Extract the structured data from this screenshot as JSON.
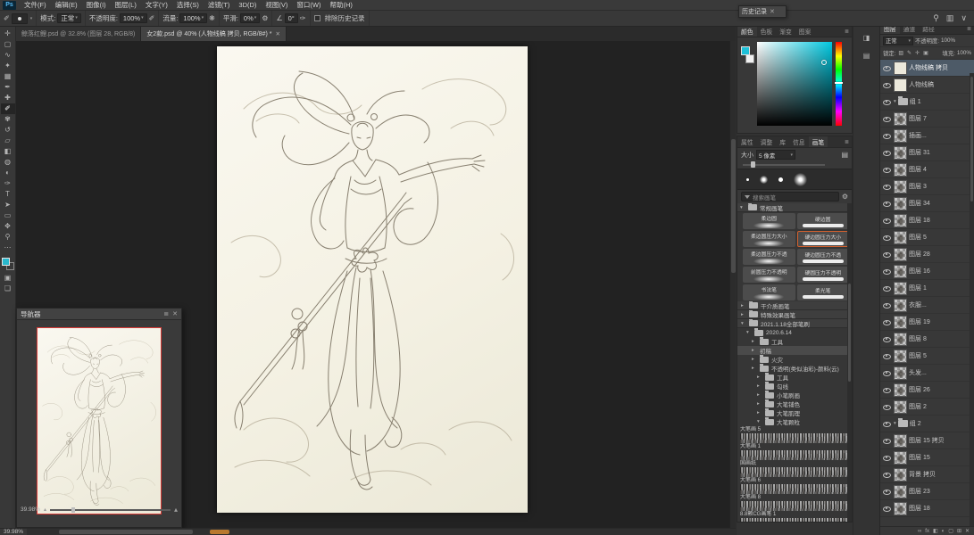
{
  "app": {
    "logo": "Ps"
  },
  "ui": {
    "close_glyph": "✕",
    "caret": "∨",
    "menu_glyph": "≣",
    "collapse_glyph": "«"
  },
  "menubar": {
    "items": [
      "文件(F)",
      "编辑(E)",
      "图像(I)",
      "图层(L)",
      "文字(Y)",
      "选择(S)",
      "滤镜(T)",
      "3D(D)",
      "视图(V)",
      "窗口(W)",
      "帮助(H)"
    ]
  },
  "optionsbar": {
    "tool_glyph": "✐",
    "mode_label": "模式:",
    "mode_value": "正常",
    "opacity_label": "不透明度:",
    "opacity_value": "100%",
    "pressure_glyph": "✐",
    "flow_label": "流量:",
    "flow_value": "100%",
    "airbrush_glyph": "❋",
    "smooth_label": "平滑:",
    "smooth_value": "0%",
    "gear_glyph": "⚙",
    "angle_glyph": "∠",
    "angle_value": "0°",
    "size_pressure_glyph": "✑",
    "checkbox_label": "排除历史记录",
    "right_icons": [
      {
        "name": "search-icon",
        "glyph": "⚲"
      },
      {
        "name": "workspace-layout-icon",
        "glyph": "▥"
      },
      {
        "name": "chevron-down-icon",
        "glyph": "∨"
      }
    ]
  },
  "toolbar": {
    "foreground_color": "#29b8cd",
    "background_color": "#f2f2f2",
    "tools": [
      {
        "name": "move-tool",
        "glyph": "✛",
        "cls": ""
      },
      {
        "name": "marquee-tool",
        "glyph": "▢",
        "cls": ""
      },
      {
        "name": "lasso-tool",
        "glyph": "∿",
        "cls": ""
      },
      {
        "name": "magic-wand-tool",
        "glyph": "✦",
        "cls": ""
      },
      {
        "name": "crop-tool",
        "glyph": "▦",
        "cls": ""
      },
      {
        "name": "eyedropper-tool",
        "glyph": "✒",
        "cls": ""
      },
      {
        "name": "healing-brush-tool",
        "glyph": "✚",
        "cls": ""
      },
      {
        "name": "brush-tool",
        "glyph": "✐",
        "cls": "active"
      },
      {
        "name": "clone-stamp-tool",
        "glyph": "✾",
        "cls": ""
      },
      {
        "name": "history-brush-tool",
        "glyph": "↺",
        "cls": ""
      },
      {
        "name": "eraser-tool",
        "glyph": "▱",
        "cls": ""
      },
      {
        "name": "gradient-tool",
        "glyph": "◧",
        "cls": ""
      },
      {
        "name": "blur-tool",
        "glyph": "◍",
        "cls": ""
      },
      {
        "name": "dodge-tool",
        "glyph": "◐",
        "cls": ""
      },
      {
        "name": "pen-tool",
        "glyph": "✑",
        "cls": ""
      },
      {
        "name": "type-tool",
        "glyph": "T",
        "cls": ""
      },
      {
        "name": "path-select-tool",
        "glyph": "➤",
        "cls": ""
      },
      {
        "name": "shape-tool",
        "glyph": "▭",
        "cls": ""
      },
      {
        "name": "hand-tool",
        "glyph": "✥",
        "cls": ""
      },
      {
        "name": "zoom-tool",
        "glyph": "⚲",
        "cls": ""
      },
      {
        "name": "edit-toolbar-button",
        "glyph": "⋯",
        "cls": ""
      }
    ],
    "extra": [
      {
        "name": "quick-mask-button",
        "glyph": "▣"
      },
      {
        "name": "screen-mode-button",
        "glyph": "❏"
      }
    ]
  },
  "tabs": {
    "items": [
      {
        "label": "鲸落红鲤.psd @ 32.8% (图层 28, RGB/8)",
        "cls": ""
      },
      {
        "label": "女2款.psd @ 40% (人物线稿 拷贝, RGB/8#) *",
        "cls": "active"
      }
    ]
  },
  "statusbar": {
    "zoom": "39.98%"
  },
  "navigator": {
    "title": "导航器",
    "zoom": "39.98%"
  },
  "history_panel": {
    "title": "历史记录"
  },
  "color_panel": {
    "tabs": [
      {
        "label": "颜色",
        "cls": "active"
      },
      {
        "label": "色板"
      },
      {
        "label": "渐变"
      },
      {
        "label": "图案"
      }
    ],
    "current_color": "#1ec0d8"
  },
  "brushes_panel": {
    "tabs": [
      {
        "label": "属性"
      },
      {
        "label": "调整"
      },
      {
        "label": "库"
      },
      {
        "label": "信息"
      },
      {
        "label": "画笔",
        "cls": "active"
      }
    ],
    "size_label": "大小",
    "size_value": "5 像素",
    "search_placeholder": "搜索画笔",
    "group_regular": "常规画笔",
    "pairs": [
      {
        "left": "柔边圆",
        "right": "硬边圆"
      },
      {
        "left": "柔边圆压力大小",
        "right": "硬边圆压力大小",
        "right_cls": "sel"
      },
      {
        "left": "柔边圆压力不透",
        "right": "硬边圆压力不透"
      },
      {
        "left": "前圆压力不透明",
        "right": "硬圆压力不透明"
      },
      {
        "left": "书法笔",
        "right": "柔光笔"
      }
    ],
    "tree": [
      {
        "label": "干介质画笔",
        "cls": "grp"
      },
      {
        "label": "特殊效果画笔",
        "cls": "grp"
      },
      {
        "label": "2021.1.18全部笔刷",
        "cls": "grp open"
      },
      {
        "label": "2020.6.14",
        "cls": "ind1 open"
      },
      {
        "label": "工具",
        "cls": "ind2"
      },
      {
        "label": "初稿",
        "cls": "ind2 hl noicon"
      },
      {
        "label": "火灾",
        "cls": "ind2"
      },
      {
        "label": "不透明(类似油彩)-颜料(云)",
        "cls": "ind2"
      },
      {
        "label": "工具",
        "cls": "ind3"
      },
      {
        "label": "勾线",
        "cls": "ind3"
      },
      {
        "label": "小笔刷画",
        "cls": "ind3"
      },
      {
        "label": "大笔铺色",
        "cls": "ind3"
      },
      {
        "label": "大笔肌理",
        "cls": "ind3"
      },
      {
        "label": "大笔颗粒",
        "cls": "ind3 open"
      }
    ],
    "samples": [
      {
        "label": "大笔画 5"
      },
      {
        "label": "大笔画 1"
      },
      {
        "label": "国画纸"
      },
      {
        "label": "大笔画 6"
      },
      {
        "label": "大笔画 8"
      },
      {
        "label": "8.8颗CG画笔 1"
      }
    ]
  },
  "iconstrip": {
    "items": [
      {
        "name": "collapse-dock-chevron",
        "glyph": "«"
      },
      {
        "name": "dock-panel-icon-1",
        "glyph": "◨"
      },
      {
        "name": "dock-panel-icon-2",
        "glyph": "▤"
      }
    ]
  },
  "layers_panel": {
    "tabs": [
      {
        "label": "图层",
        "cls": "active"
      },
      {
        "label": "通道"
      },
      {
        "label": "路径"
      }
    ],
    "blend_mode": "正常",
    "opacity_label": "不透明度:",
    "opacity_value": "100%",
    "lock_label": "锁定:",
    "fill_label": "填充:",
    "fill_value": "100%",
    "lock_icons": [
      {
        "name": "lock-transparency-icon",
        "glyph": "▨"
      },
      {
        "name": "lock-pixels-icon",
        "glyph": "✎"
      },
      {
        "name": "lock-position-icon",
        "glyph": "✛"
      },
      {
        "name": "lock-all-icon",
        "glyph": "▣"
      }
    ],
    "items": [
      {
        "name": "人物线稿 拷贝",
        "cls": "selected white"
      },
      {
        "name": "人物线稿",
        "cls": "white"
      },
      {
        "name": "组 1",
        "cls": "group"
      },
      {
        "name": "图层 7",
        "cls": ""
      },
      {
        "name": "插画...",
        "cls": ""
      },
      {
        "name": "图层 31",
        "cls": ""
      },
      {
        "name": "图层 4",
        "cls": ""
      },
      {
        "name": "图层 3",
        "cls": ""
      },
      {
        "name": "图层 34",
        "cls": ""
      },
      {
        "name": "图层 18",
        "cls": ""
      },
      {
        "name": "图层 5",
        "cls": ""
      },
      {
        "name": "图层 28",
        "cls": ""
      },
      {
        "name": "图层 16",
        "cls": ""
      },
      {
        "name": "图层 1",
        "cls": ""
      },
      {
        "name": "衣服...",
        "cls": ""
      },
      {
        "name": "图层 19",
        "cls": ""
      },
      {
        "name": "图层 8",
        "cls": ""
      },
      {
        "name": "图层 5",
        "cls": ""
      },
      {
        "name": "头发...",
        "cls": ""
      },
      {
        "name": "图层 26",
        "cls": ""
      },
      {
        "name": "图层 2",
        "cls": ""
      },
      {
        "name": "组 2",
        "cls": "group"
      },
      {
        "name": "图层 15 拷贝",
        "cls": ""
      },
      {
        "name": "图层 15",
        "cls": ""
      },
      {
        "name": "背景 拷贝",
        "cls": ""
      },
      {
        "name": "图层 23",
        "cls": ""
      },
      {
        "name": "图层 18",
        "cls": ""
      }
    ],
    "footer_icons": [
      {
        "name": "link-layers-icon",
        "glyph": "∞"
      },
      {
        "name": "layer-effects-icon",
        "glyph": "fx"
      },
      {
        "name": "layer-mask-icon",
        "glyph": "◧"
      },
      {
        "name": "adjustment-layer-icon",
        "glyph": "◐"
      },
      {
        "name": "layer-group-icon",
        "glyph": "▢"
      },
      {
        "name": "new-layer-icon",
        "glyph": "⊞"
      },
      {
        "name": "delete-layer-icon",
        "glyph": "✕"
      }
    ]
  }
}
